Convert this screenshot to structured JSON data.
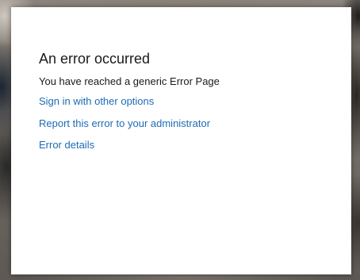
{
  "error_dialog": {
    "title": "An error occurred",
    "message": "You have reached a generic Error Page",
    "links": [
      {
        "label": "Sign in with other options"
      },
      {
        "label": "Report this error to your administrator"
      },
      {
        "label": "Error details"
      }
    ]
  },
  "colors": {
    "link": "#1e6bb5",
    "text": "#1a1a1a",
    "dialog_background": "#ffffff"
  }
}
